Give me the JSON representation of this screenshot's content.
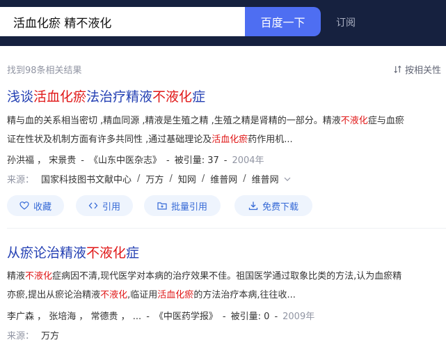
{
  "header": {
    "search_value": "活血化瘀 精不液化",
    "search_button": "百度一下",
    "subscribe": "订阅"
  },
  "results_bar": {
    "count_text": "找到98条相关结果",
    "sort_label": "按相关性"
  },
  "results": [
    {
      "title_parts": [
        "浅谈",
        "活血化瘀",
        "法治疗精液",
        "不液化",
        "症"
      ],
      "abstract_line1": [
        "精与血的关系相当密切 ,精血同源 ,精液是生殖之精 ,生殖之精是肾精的一部分。精液",
        "不液化",
        "症与血瘀"
      ],
      "abstract_line2": [
        "证在性状及机制方面有许多共同性 ,通过基础理论及",
        "活血化瘀",
        "药作用机..."
      ],
      "authors": "孙洪福 ， 宋景贵",
      "journal": "《山东中医杂志》",
      "cited_label": "被引量:",
      "cited": "37",
      "year": "2004年",
      "source_label": "来源：",
      "sources": [
        "国家科技图书文献中心",
        "万方",
        "知网",
        "维普网",
        "维普网"
      ],
      "actions": {
        "favorite": "收藏",
        "cite": "引用",
        "batch_cite": "批量引用",
        "download": "免费下载"
      }
    },
    {
      "title_parts": [
        "从瘀论治精液",
        "不液化",
        "症"
      ],
      "abstract_line1": [
        "精液",
        "不液化",
        "症病因不清,现代医学对本病的治疗效果不佳。祖国医学通过取象比类的方法,认为血瘀精"
      ],
      "abstract_line2": [
        "亦瘀,提出从瘀论治精液",
        "不液化",
        ",临证用",
        "活血化瘀",
        "的方法治疗本病,往往收..."
      ],
      "authors": "李广森 ， 张培海 ， 常德贵 ， ...",
      "journal": "《中医药学报》",
      "cited_label": "被引量:",
      "cited": "0",
      "year": "2009年",
      "source_label": "来源：",
      "sources": [
        "万方"
      ]
    }
  ],
  "colors": {
    "header_bg": "#16213f",
    "search_button_bg": "#4e6ef2",
    "title_blue": "#2440b3",
    "highlight_red": "#e01818",
    "pill_bg": "#eef4fd",
    "pill_text": "#3569d6"
  }
}
